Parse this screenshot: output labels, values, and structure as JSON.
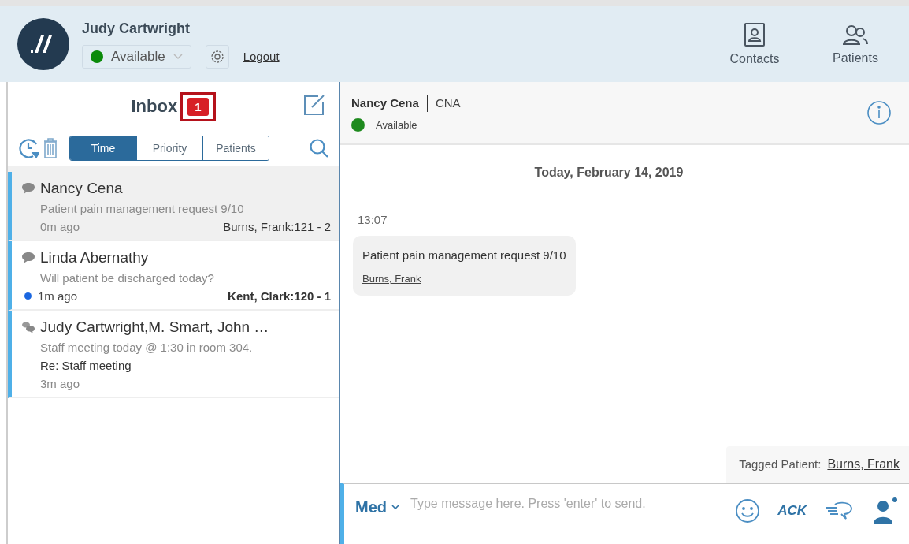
{
  "user": {
    "name": "Judy Cartwright",
    "status": "Available",
    "logout": "Logout"
  },
  "nav": [
    {
      "label": "Contacts",
      "kind": "contacts"
    },
    {
      "label": "Patients",
      "kind": "patients"
    }
  ],
  "inbox": {
    "title": "Inbox",
    "badge": "1",
    "filters": [
      {
        "label": "Time",
        "selected": true
      },
      {
        "label": "Priority",
        "selected": false
      },
      {
        "label": "Patients",
        "selected": false
      }
    ],
    "conversations": [
      {
        "kind": "single",
        "name": "Nancy Cena",
        "preview": "Patient pain management request 9/10",
        "time": "0m ago",
        "patient": "Burns, Frank:121 - 2",
        "selected": true,
        "unread": false
      },
      {
        "kind": "single",
        "name": "Linda Abernathy",
        "preview": "Will patient be discharged today?",
        "time": "1m ago",
        "patient": "Kent, Clark:120 - 1",
        "selected": false,
        "unread": true
      },
      {
        "kind": "group",
        "name": "Judy Cartwright,M. Smart, John …",
        "preview": "Staff meeting today @ 1:30 in room 304.",
        "subject": "Re: Staff meeting",
        "time": "3m ago",
        "selected": false,
        "unread": false
      }
    ]
  },
  "chat": {
    "contact": "Nancy Cena",
    "role": "CNA",
    "status": "Available",
    "date": "Today, February 14, 2019",
    "messages": [
      {
        "time": "13:07",
        "text": "Patient pain management request 9/10",
        "patient": "Burns, Frank"
      }
    ],
    "tagged_label": "Tagged Patient:",
    "tagged_patient": "Burns, Frank",
    "composer": {
      "priority": "Med",
      "placeholder": "Type message here. Press 'enter' to send.",
      "ack": "ACK"
    }
  }
}
